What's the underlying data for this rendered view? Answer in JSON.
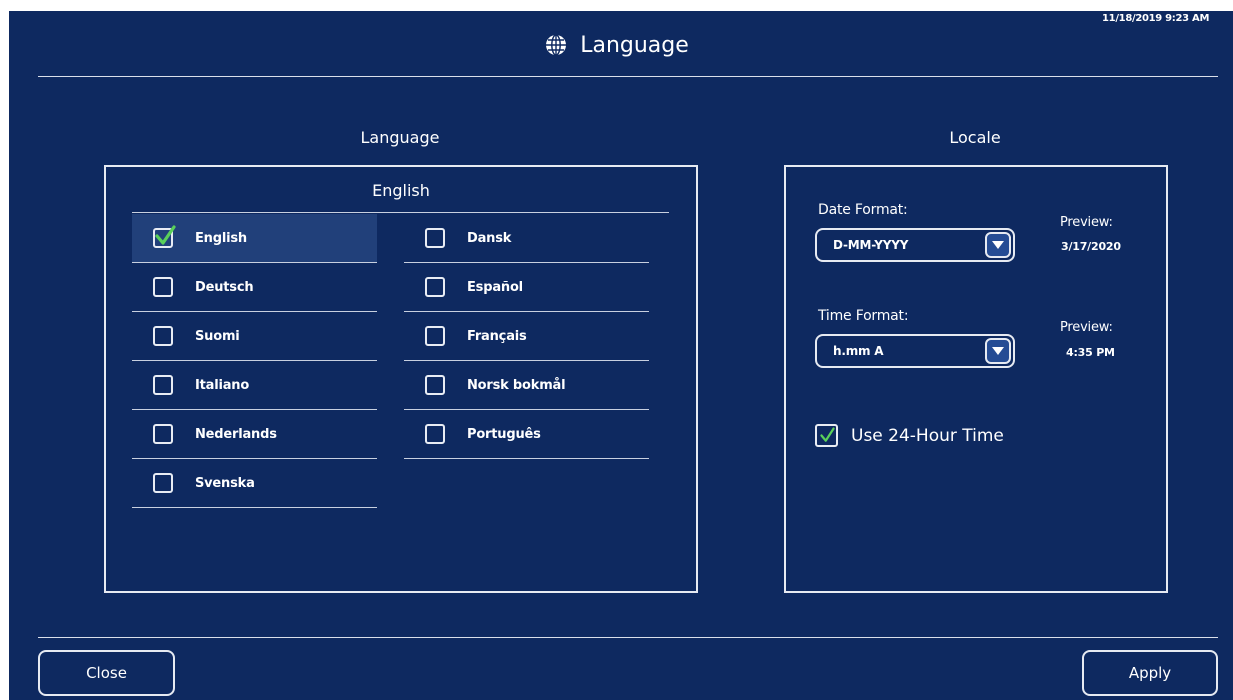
{
  "header": {
    "timestamp": "11/18/2019 9:23 AM",
    "title": "Language",
    "icon": "globe-icon"
  },
  "language_section": {
    "title": "Language",
    "current": "English",
    "languages": [
      {
        "label": "English",
        "checked": true
      },
      {
        "label": "Deutsch",
        "checked": false
      },
      {
        "label": "Suomi",
        "checked": false
      },
      {
        "label": "Italiano",
        "checked": false
      },
      {
        "label": "Nederlands",
        "checked": false
      },
      {
        "label": "Svenska",
        "checked": false
      },
      {
        "label": "Dansk",
        "checked": false
      },
      {
        "label": "Español",
        "checked": false
      },
      {
        "label": "Français",
        "checked": false
      },
      {
        "label": "Norsk bokmål",
        "checked": false
      },
      {
        "label": "Português",
        "checked": false
      }
    ]
  },
  "locale_section": {
    "title": "Locale",
    "date_format": {
      "label": "Date Format:",
      "value": "D-MM-YYYY",
      "preview_label": "Preview:",
      "preview_value": "3/17/2020"
    },
    "time_format": {
      "label": "Time Format:",
      "value": "h.mm A",
      "preview_label": "Preview:",
      "preview_value": "4:35 PM"
    },
    "use_24_hour": {
      "label": "Use 24-Hour Time",
      "checked": true
    }
  },
  "footer": {
    "close_label": "Close",
    "apply_label": "Apply"
  },
  "colors": {
    "background": "#0e2960",
    "selected_row": "#21407a",
    "checkmark": "#5ad05a",
    "border": "#e6eaf2"
  }
}
